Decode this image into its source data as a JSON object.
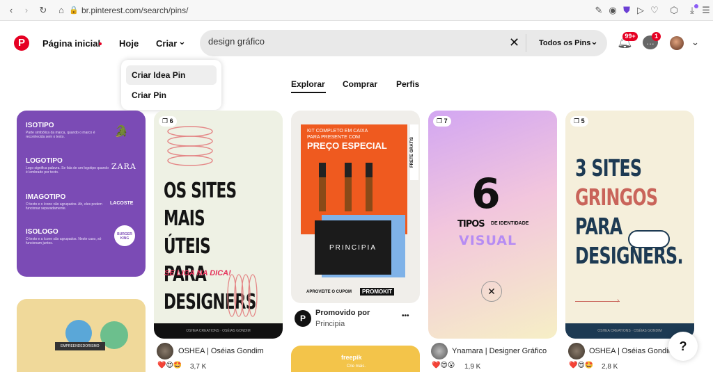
{
  "browser": {
    "url": "br.pinterest.com/search/pins/",
    "back_icon": "arrow-left",
    "forward_icon": "arrow-right",
    "reload_icon": "reload",
    "lock_icon": "lock",
    "notif_badge_color": "#8b5cf6"
  },
  "header": {
    "logo_icon": "pinterest-logo",
    "nav": {
      "home": "Página inicial",
      "today": "Hoje",
      "create": "Criar"
    },
    "search": {
      "value": "design gráfico",
      "filter": "Todos os Pins"
    },
    "notifications_badge": "99+",
    "messages_badge": "1",
    "accent": "#e60023"
  },
  "create_menu": {
    "items": [
      "Criar Idea Pin",
      "Criar Pin"
    ]
  },
  "tabs": [
    "Explorar",
    "Comprar",
    "Perfis"
  ],
  "pins": [
    {
      "id": "isotipo",
      "bg": "#7b4bb5",
      "rows": [
        {
          "title": "ISOTIPO",
          "desc": "Parte simbólica da marca, quando o marco é reconhecida sem o texto.",
          "logo": "🐊"
        },
        {
          "title": "LOGOTIPO",
          "desc": "Logo significa palavra. Se fala de um logotipo quando é lembrado por texto.",
          "logo": "ZARA"
        },
        {
          "title": "IMAGOTIPO",
          "desc": "O texto e o ícone vão agrupados. Ah, eles podem funcionar separadamente.",
          "logo": "LACOSTE"
        },
        {
          "title": "ISOLOGO",
          "desc": "O texto e a ícone são agrupados. Neste caso, só funcionam juntos.",
          "logo": "BURGER KING"
        }
      ]
    },
    {
      "id": "sites-uteis",
      "count": "6",
      "lines": [
        "OS SITES MAIS",
        "ÚTEIS PARA",
        "DESIGNERS"
      ],
      "sub": "SE LIGA NA DICA!",
      "footer": "OSHEA CREATIONS · OSÉIAS GONDIM",
      "author": "OSHEA | Oséias Gondim",
      "reactions": "3,7 K"
    },
    {
      "id": "principia",
      "banner1": "KIT COMPLETO EM CAIXA",
      "banner2": "PARA PRESENTE COM",
      "banner3": "PREÇO ESPECIAL",
      "side": "FRETE GRÁTIS",
      "box": "PRINCIPIA",
      "coupon_lbl": "APROVEITE O CUPOM",
      "coupon": "PROMOKIT",
      "promoted": "Promovido por",
      "brand": "Principia",
      "brand_initial": "P",
      "more": "•••"
    },
    {
      "id": "tipos",
      "count": "7",
      "big": "6",
      "l1": "TIPOS",
      "l2": "DE IDENTIDADE",
      "l3": "VISUAL",
      "author": "Ynamara | Designer Gráfico",
      "reactions": "1,9 K"
    },
    {
      "id": "gringos",
      "count": "5",
      "lines": [
        "3 SITES",
        "GRINGOS",
        "PARA",
        "DESIGNERS."
      ],
      "footer": "OSHEA CREATIONS · OSÉIAS GONDIM",
      "author": "OSHEA | Oséias Gondim",
      "reactions": "2,8 K"
    }
  ],
  "bottom": {
    "left_tag": "EMPREENDEDORISMO",
    "freepik": "freepik",
    "freepik_sub": "Crie mais."
  },
  "help": "?"
}
